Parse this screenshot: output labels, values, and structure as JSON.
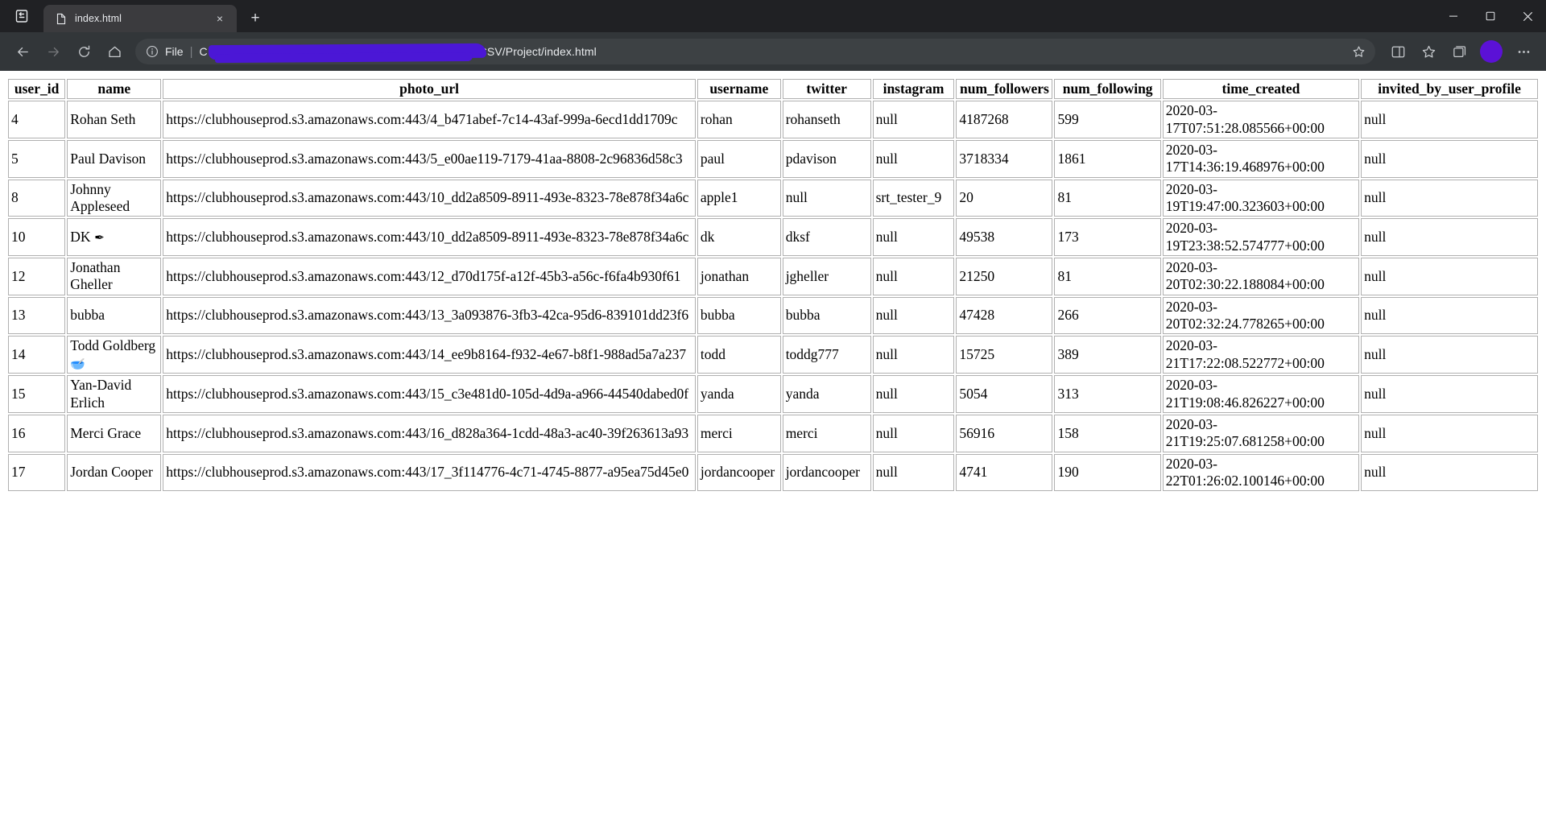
{
  "browser": {
    "workspace_icon": "workspace-icon",
    "tab": {
      "title": "index.html",
      "favicon": "document-icon",
      "close_label": "×"
    },
    "new_tab_label": "+",
    "window_controls": {
      "minimize": "—",
      "maximize": "❐",
      "close": "✕"
    },
    "nav": {
      "back": "←",
      "forward": "→",
      "reload": "⟳",
      "home": "⌂"
    },
    "omnibox": {
      "info_icon": "info-circle-icon",
      "file_label": "File",
      "separator": "|",
      "url_prefix": "C",
      "url_visible": "/CSV/Project/index.html",
      "redacted": true,
      "redaction_color": "#4b17d6",
      "favorite_icon": "star-icon",
      "collections_icon": "collections-icon"
    },
    "toolbar_right": {
      "split_screen_icon": "split-screen-icon",
      "favorites_icon": "favorites-icon",
      "collections_icon": "collections-icon",
      "profile_avatar": "avatar",
      "settings_icon": "ellipsis-icon"
    }
  },
  "table": {
    "headers": [
      "user_id",
      "name",
      "photo_url",
      "username",
      "twitter",
      "instagram",
      "num_followers",
      "num_following",
      "time_created",
      "invited_by_user_profile"
    ],
    "rows": [
      {
        "user_id": "4",
        "name": "Rohan Seth",
        "name_emoji": "",
        "photo_url": "https://clubhouseprod.s3.amazonaws.com:443/4_b471abef-7c14-43af-999a-6ecd1dd1709c",
        "username": "rohan",
        "twitter": "rohanseth",
        "instagram": "null",
        "num_followers": "4187268",
        "num_following": "599",
        "time_created": "2020-03-17T07:51:28.085566+00:00",
        "invited_by_user_profile": "null"
      },
      {
        "user_id": "5",
        "name": "Paul Davison",
        "name_emoji": "",
        "photo_url": "https://clubhouseprod.s3.amazonaws.com:443/5_e00ae119-7179-41aa-8808-2c96836d58c3",
        "username": "paul",
        "twitter": "pdavison",
        "instagram": "null",
        "num_followers": "3718334",
        "num_following": "1861",
        "time_created": "2020-03-17T14:36:19.468976+00:00",
        "invited_by_user_profile": "null"
      },
      {
        "user_id": "8",
        "name": "Johnny Appleseed",
        "name_emoji": "",
        "photo_url": "https://clubhouseprod.s3.amazonaws.com:443/10_dd2a8509-8911-493e-8323-78e878f34a6c",
        "username": "apple1",
        "twitter": "null",
        "instagram": "srt_tester_9",
        "num_followers": "20",
        "num_following": "81",
        "time_created": "2020-03-19T19:47:00.323603+00:00",
        "invited_by_user_profile": "null"
      },
      {
        "user_id": "10",
        "name": "DK",
        "name_emoji": "✒",
        "photo_url": "https://clubhouseprod.s3.amazonaws.com:443/10_dd2a8509-8911-493e-8323-78e878f34a6c",
        "username": "dk",
        "twitter": "dksf",
        "instagram": "null",
        "num_followers": "49538",
        "num_following": "173",
        "time_created": "2020-03-19T23:38:52.574777+00:00",
        "invited_by_user_profile": "null"
      },
      {
        "user_id": "12",
        "name": "Jonathan Gheller",
        "name_emoji": "",
        "photo_url": "https://clubhouseprod.s3.amazonaws.com:443/12_d70d175f-a12f-45b3-a56c-f6fa4b930f61",
        "username": "jonathan",
        "twitter": "jgheller",
        "instagram": "null",
        "num_followers": "21250",
        "num_following": "81",
        "time_created": "2020-03-20T02:30:22.188084+00:00",
        "invited_by_user_profile": "null"
      },
      {
        "user_id": "13",
        "name": "bubba",
        "name_emoji": "",
        "photo_url": "https://clubhouseprod.s3.amazonaws.com:443/13_3a093876-3fb3-42ca-95d6-839101dd23f6",
        "username": "bubba",
        "twitter": "bubba",
        "instagram": "null",
        "num_followers": "47428",
        "num_following": "266",
        "time_created": "2020-03-20T02:32:24.778265+00:00",
        "invited_by_user_profile": "null"
      },
      {
        "user_id": "14",
        "name": "Todd Goldberg",
        "name_emoji": "🥣",
        "photo_url": "https://clubhouseprod.s3.amazonaws.com:443/14_ee9b8164-f932-4e67-b8f1-988ad5a7a237",
        "username": "todd",
        "twitter": "toddg777",
        "instagram": "null",
        "num_followers": "15725",
        "num_following": "389",
        "time_created": "2020-03-21T17:22:08.522772+00:00",
        "invited_by_user_profile": "null"
      },
      {
        "user_id": "15",
        "name": "Yan-David Erlich",
        "name_emoji": "",
        "photo_url": "https://clubhouseprod.s3.amazonaws.com:443/15_c3e481d0-105d-4d9a-a966-44540dabed0f",
        "username": "yanda",
        "twitter": "yanda",
        "instagram": "null",
        "num_followers": "5054",
        "num_following": "313",
        "time_created": "2020-03-21T19:08:46.826227+00:00",
        "invited_by_user_profile": "null"
      },
      {
        "user_id": "16",
        "name": "Merci Grace",
        "name_emoji": "",
        "photo_url": "https://clubhouseprod.s3.amazonaws.com:443/16_d828a364-1cdd-48a3-ac40-39f263613a93",
        "username": "merci",
        "twitter": "merci",
        "instagram": "null",
        "num_followers": "56916",
        "num_following": "158",
        "time_created": "2020-03-21T19:25:07.681258+00:00",
        "invited_by_user_profile": "null"
      },
      {
        "user_id": "17",
        "name": "Jordan Cooper",
        "name_emoji": "",
        "photo_url": "https://clubhouseprod.s3.amazonaws.com:443/17_3f114776-4c71-4745-8877-a95ea75d45e0",
        "username": "jordancooper",
        "twitter": "jordancooper",
        "instagram": "null",
        "num_followers": "4741",
        "num_following": "190",
        "time_created": "2020-03-22T01:26:02.100146+00:00",
        "invited_by_user_profile": "null"
      }
    ]
  }
}
